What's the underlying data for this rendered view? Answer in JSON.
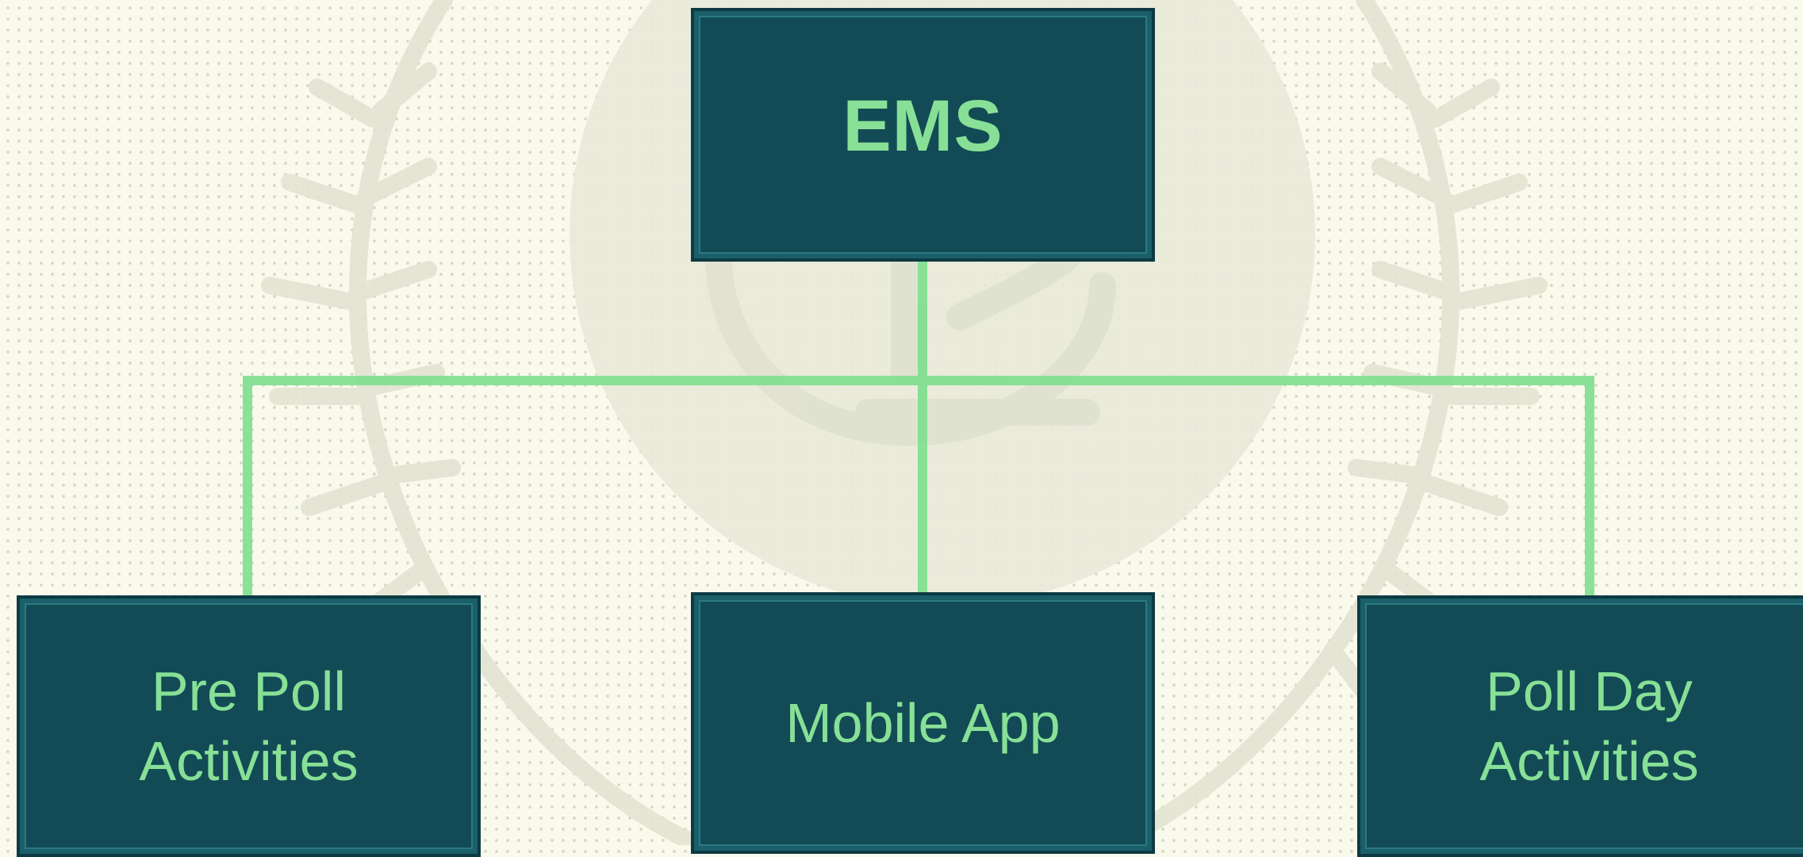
{
  "diagram": {
    "root": {
      "label": "EMS"
    },
    "children": [
      {
        "id": "pre-poll",
        "label": "Pre Poll\nActivities"
      },
      {
        "id": "mobile-app",
        "label": "Mobile App"
      },
      {
        "id": "poll-day",
        "label": "Poll Day\nActivities"
      }
    ]
  },
  "colors": {
    "background": "#fafaec",
    "box_fill": "#124b55",
    "box_text": "#8ee89a",
    "connector": "#7fdf8f",
    "watermark": "#e7e8d8"
  },
  "icons": {
    "watermark": "emblem-watermark-icon"
  }
}
